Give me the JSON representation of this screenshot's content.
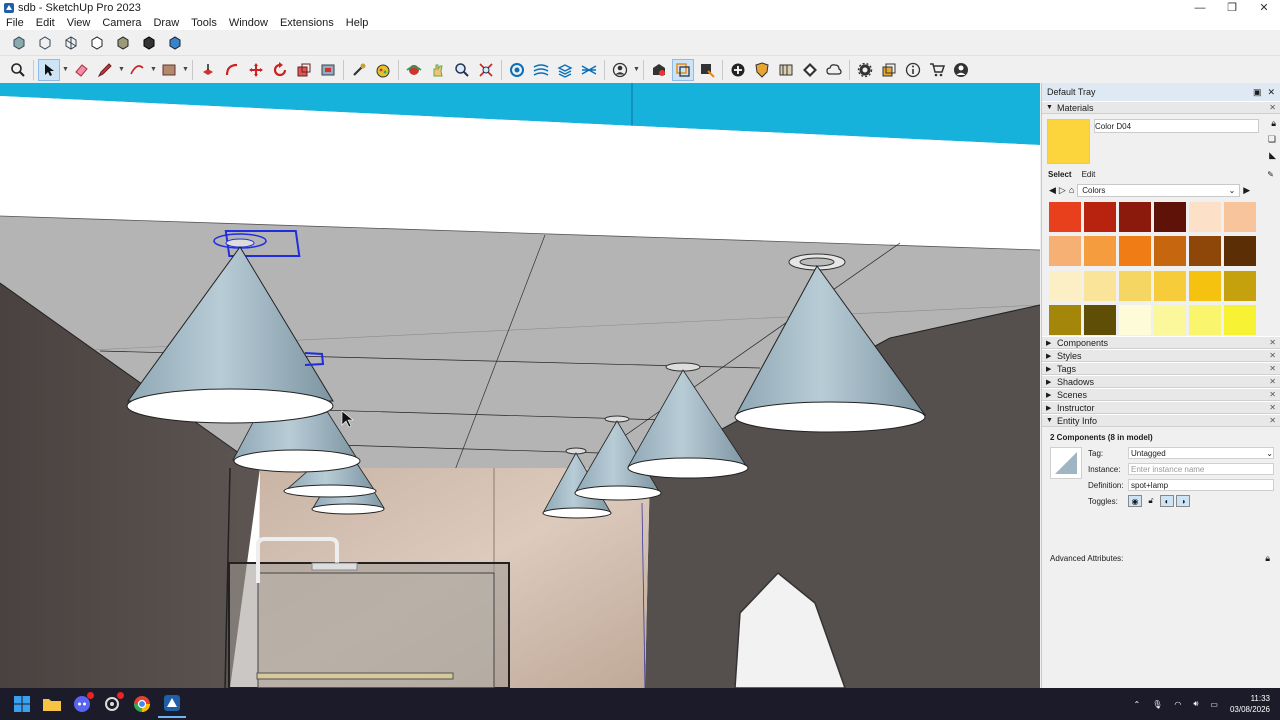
{
  "window": {
    "title": "sdb - SketchUp Pro 2023",
    "minimize": "—",
    "maximize": "❐",
    "close": "✕"
  },
  "menu": [
    "File",
    "Edit",
    "View",
    "Camera",
    "Draw",
    "Tools",
    "Window",
    "Extensions",
    "Help"
  ],
  "colors": {
    "sky": "#17b2dc",
    "ceiling": "#b5b5b5",
    "wall": "#4e4744",
    "lamp": "#9fb6c2",
    "selection": "#1e2de0",
    "current_material": "#fcd53c"
  },
  "tray": {
    "title": "Default Tray",
    "materials": {
      "section": "Materials",
      "current_name": "Color D04",
      "tab_select": "Select",
      "tab_edit": "Edit",
      "library": "Colors",
      "palette": [
        "#e8401c",
        "#b7230f",
        "#8b1a0c",
        "#5e1208",
        "#fde0c8",
        "#f7c49b",
        "#f7b073",
        "#f59c3e",
        "#f07c15",
        "#c66710",
        "#8e4708",
        "#5c2e05",
        "#fcefc5",
        "#f9e49a",
        "#f6d663",
        "#f6cc3b",
        "#f5c20f",
        "#c5a10d",
        "#a3860a",
        "#5e4e06",
        "#fdfbd8",
        "#fbf89b",
        "#f9f56c",
        "#f8f235"
      ]
    },
    "sections": [
      "Components",
      "Styles",
      "Tags",
      "Shadows",
      "Scenes",
      "Instructor"
    ],
    "entity_info": {
      "section": "Entity Info",
      "heading": "2 Components (8 in model)",
      "tag_label": "Tag:",
      "tag_value": "Untagged",
      "instance_label": "Instance:",
      "instance_placeholder": "Enter instance name",
      "definition_label": "Definition:",
      "definition_value": "spot+lamp",
      "toggles_label": "Toggles:",
      "advanced": "Advanced Attributes:"
    }
  },
  "taskbar": {
    "clock_time": "11:33",
    "clock_date": "03/08/2026"
  }
}
